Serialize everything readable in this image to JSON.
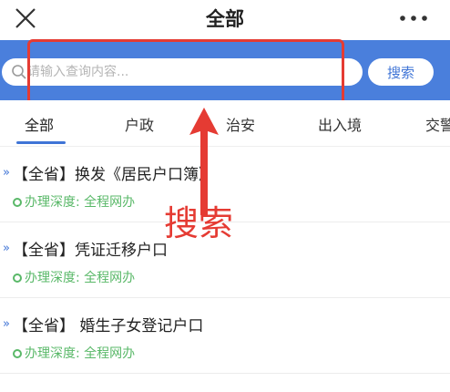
{
  "header": {
    "title": "全部",
    "close_icon": "close-icon",
    "more_icon": "more-icon"
  },
  "search": {
    "placeholder": "请输入查询内容...",
    "value": "",
    "button_label": "搜索",
    "band_color": "#4a7fdc"
  },
  "tabs": [
    {
      "label": "全部",
      "active": true
    },
    {
      "label": "户政",
      "active": false
    },
    {
      "label": "治安",
      "active": false
    },
    {
      "label": "出入境",
      "active": false
    },
    {
      "label": "交警",
      "active": false
    }
  ],
  "annotation": {
    "label": "搜索",
    "color": "#e53b33"
  },
  "items": [
    {
      "title": "【全省】换发《居民户口簿》",
      "depth_label": "办理深度:",
      "depth_value": "全程网办"
    },
    {
      "title": "【全省】凭证迁移户口",
      "depth_label": "办理深度:",
      "depth_value": "全程网办"
    },
    {
      "title": "【全省】 婚生子女登记户口",
      "depth_label": "办理深度:",
      "depth_value": "全程网办"
    }
  ],
  "colors": {
    "accent": "#3f74d6",
    "depth_green": "#59b868"
  }
}
